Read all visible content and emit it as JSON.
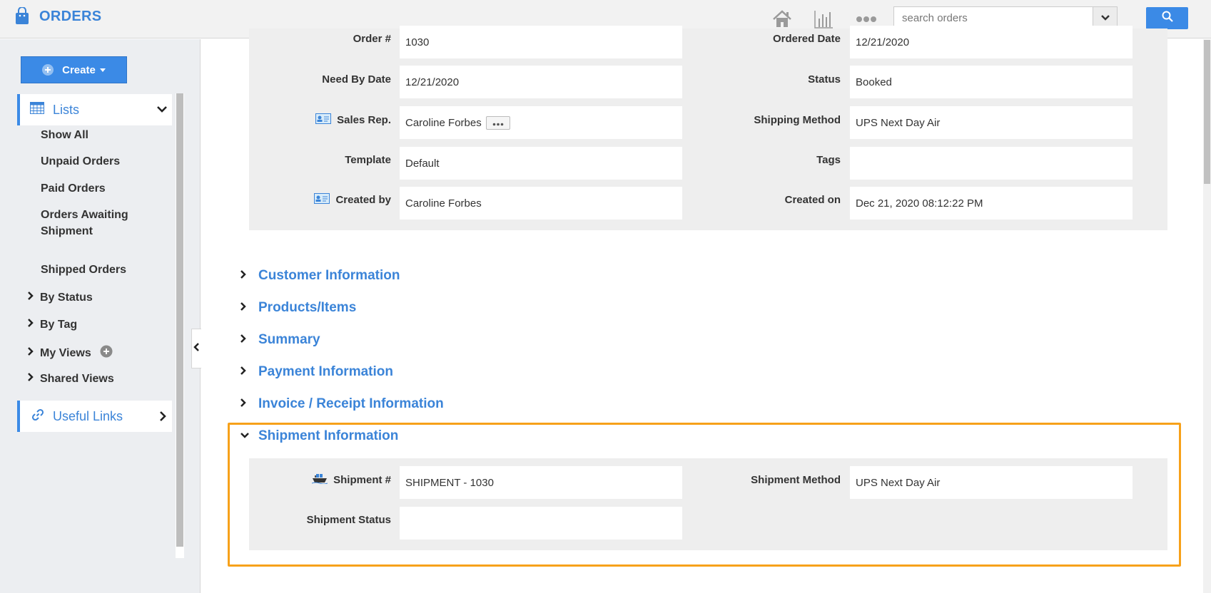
{
  "app": {
    "title": "ORDERS",
    "icon": "shopping-bag-icon"
  },
  "topbar": {
    "icons": [
      "home-icon",
      "chart-icon",
      "more-icon"
    ],
    "search": {
      "placeholder": "search orders",
      "value": ""
    },
    "search_button_icon": "search-icon"
  },
  "sidebar": {
    "create_label": "Create",
    "lists": {
      "label": "Lists",
      "items": [
        "Show All",
        "Unpaid Orders",
        "Paid Orders",
        "Orders Awaiting Shipment",
        "Shipped Orders"
      ],
      "groups": [
        "By Status",
        "By Tag",
        "My Views",
        "Shared Views"
      ]
    },
    "useful_links": {
      "label": "Useful Links"
    }
  },
  "order_details": {
    "order_no": {
      "label": "Order #",
      "value": "1030"
    },
    "ordered_date": {
      "label": "Ordered Date",
      "value": "12/21/2020"
    },
    "need_by_date": {
      "label": "Need By Date",
      "value": "12/21/2020"
    },
    "status": {
      "label": "Status",
      "value": "Booked"
    },
    "sales_rep": {
      "label": "Sales Rep.",
      "value": "Caroline Forbes"
    },
    "shipping_method": {
      "label": "Shipping Method",
      "value": "UPS Next Day Air"
    },
    "template": {
      "label": "Template",
      "value": "Default"
    },
    "tags": {
      "label": "Tags",
      "value": ""
    },
    "created_by": {
      "label": "Created by",
      "value": "Caroline Forbes"
    },
    "created_on": {
      "label": "Created on",
      "value": "Dec 21, 2020 08:12:22 PM"
    }
  },
  "sections": {
    "customer": "Customer Information",
    "products": "Products/Items",
    "summary": "Summary",
    "payment": "Payment Information",
    "invoice": "Invoice / Receipt Information",
    "shipment": "Shipment Information"
  },
  "shipment": {
    "shipment_no": {
      "label": "Shipment #",
      "value": "SHIPMENT - 1030"
    },
    "shipment_method": {
      "label": "Shipment Method",
      "value": "UPS Next Day Air"
    },
    "shipment_status": {
      "label": "Shipment Status",
      "value": ""
    }
  },
  "colors": {
    "accent": "#3b84d8",
    "button": "#3b8ae6",
    "highlight": "#f7a11a"
  }
}
